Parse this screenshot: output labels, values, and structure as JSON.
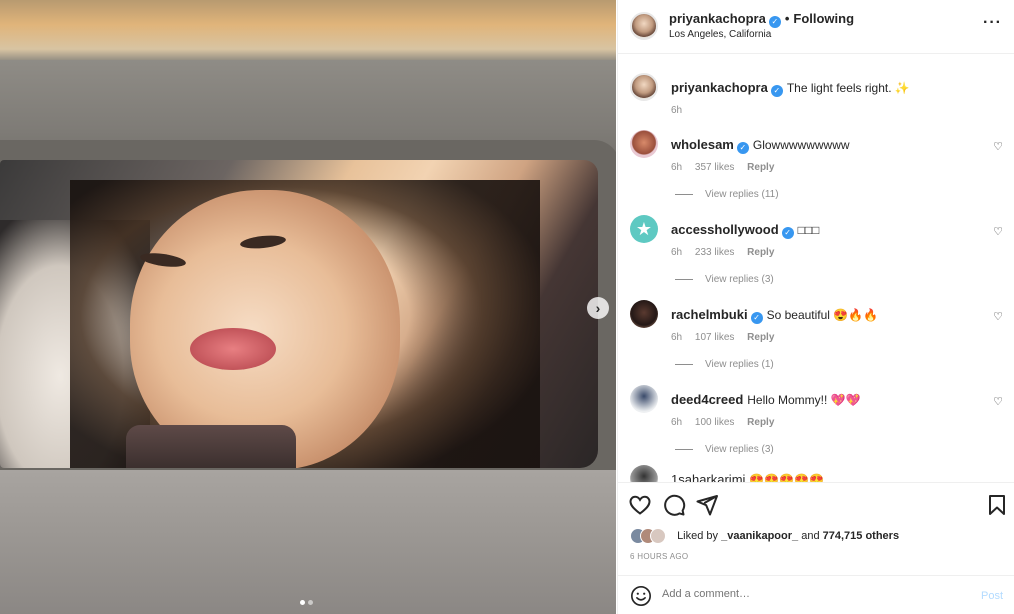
{
  "post": {
    "author": "priyankachopra",
    "location": "Los Angeles, California",
    "following_label": "Following",
    "more_icon": "more-horizontal-icon",
    "next_icon": "chevron-right-icon",
    "carousel_dots": 2,
    "carousel_active": 1
  },
  "caption": {
    "username": "priyankachopra",
    "text": "The light feels right. ✨",
    "time": "6h"
  },
  "comments": [
    {
      "username": "wholesam",
      "verified": true,
      "text": "Glowwwwwwwww",
      "time": "6h",
      "likes": "357 likes",
      "reply": "Reply",
      "replies": "View replies (11)"
    },
    {
      "username": "accesshollywood",
      "verified": true,
      "text": "□□□",
      "time": "6h",
      "likes": "233 likes",
      "reply": "Reply",
      "replies": "View replies (3)"
    },
    {
      "username": "rachelmbuki",
      "verified": true,
      "text": "So beautiful 😍🔥🔥",
      "time": "6h",
      "likes": "107 likes",
      "reply": "Reply",
      "replies": "View replies (1)"
    },
    {
      "username": "deed4creed",
      "verified": false,
      "text": "Hello Mommy!! 💖💖",
      "time": "6h",
      "likes": "100 likes",
      "reply": "Reply",
      "replies": "View replies (3)"
    },
    {
      "username": "1saharkarimi",
      "verified": false,
      "text": "😍😍😍😍😍",
      "time": "",
      "likes": "",
      "reply": "",
      "replies": ""
    }
  ],
  "actions": {
    "liked_by_prefix": "Liked by",
    "liked_by_user": "_vaanikapoor_",
    "liked_by_and": "and",
    "likes_count": "774,715 others",
    "time_ago": "6 HOURS AGO"
  },
  "add_comment": {
    "placeholder": "Add a comment…",
    "post_label": "Post"
  },
  "colors": {
    "verified": "#3897f0",
    "muted": "#8e8e8e",
    "post_disabled": "#b3dbff"
  }
}
